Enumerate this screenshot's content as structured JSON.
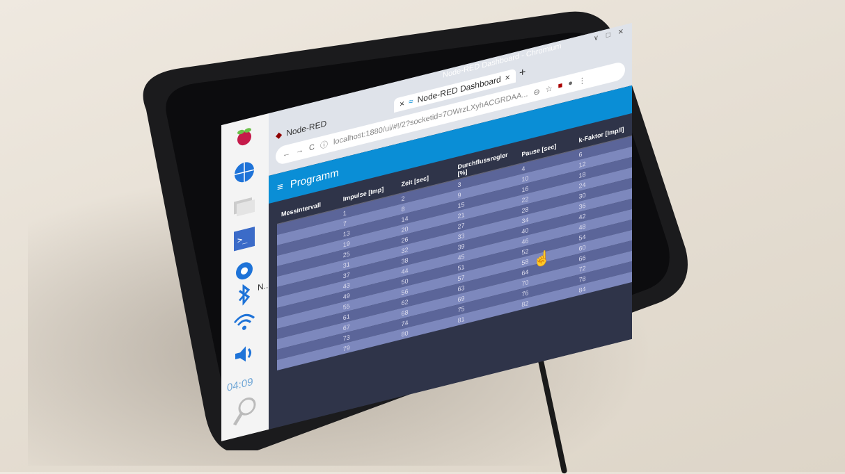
{
  "chrome": {
    "window_title": "Node-RED Dashboard - Chromium",
    "tabs": [
      {
        "label": "Node-RED"
      },
      {
        "label": "Node-RED Dashboard"
      }
    ],
    "url": "localhost:1880/ui/#!/2?socketid=7OWrzLXyhACGRDAA...",
    "close_tab": "×",
    "new_tab": "+"
  },
  "sidebar": {
    "clock": "04:09",
    "app_label": "N..."
  },
  "dashboard": {
    "title": "Programm",
    "columns": [
      "Messintervall",
      "Impulse [Imp]",
      "Zeit [sec]",
      "Durchflussregler [%]",
      "Pause [sec]",
      "k-Faktor [Imp/l]"
    ],
    "rows": [
      [
        "",
        "1",
        "2",
        "3",
        "4",
        "6"
      ],
      [
        "",
        "7",
        "8",
        "9",
        "10",
        "12"
      ],
      [
        "",
        "13",
        "14",
        "15",
        "16",
        "18"
      ],
      [
        "",
        "19",
        "20",
        "21",
        "22",
        "24"
      ],
      [
        "",
        "25",
        "26",
        "27",
        "28",
        "30"
      ],
      [
        "",
        "31",
        "32",
        "33",
        "34",
        "36"
      ],
      [
        "",
        "37",
        "38",
        "39",
        "40",
        "42"
      ],
      [
        "",
        "43",
        "44",
        "45",
        "46",
        "48"
      ],
      [
        "",
        "49",
        "50",
        "51",
        "52",
        "54"
      ],
      [
        "",
        "55",
        "56",
        "57",
        "58",
        "60"
      ],
      [
        "",
        "61",
        "62",
        "63",
        "64",
        "66"
      ],
      [
        "",
        "67",
        "68",
        "69",
        "70",
        "72"
      ],
      [
        "",
        "73",
        "74",
        "75",
        "76",
        "78"
      ],
      [
        "",
        "79",
        "80",
        "81",
        "82",
        "84"
      ]
    ]
  }
}
